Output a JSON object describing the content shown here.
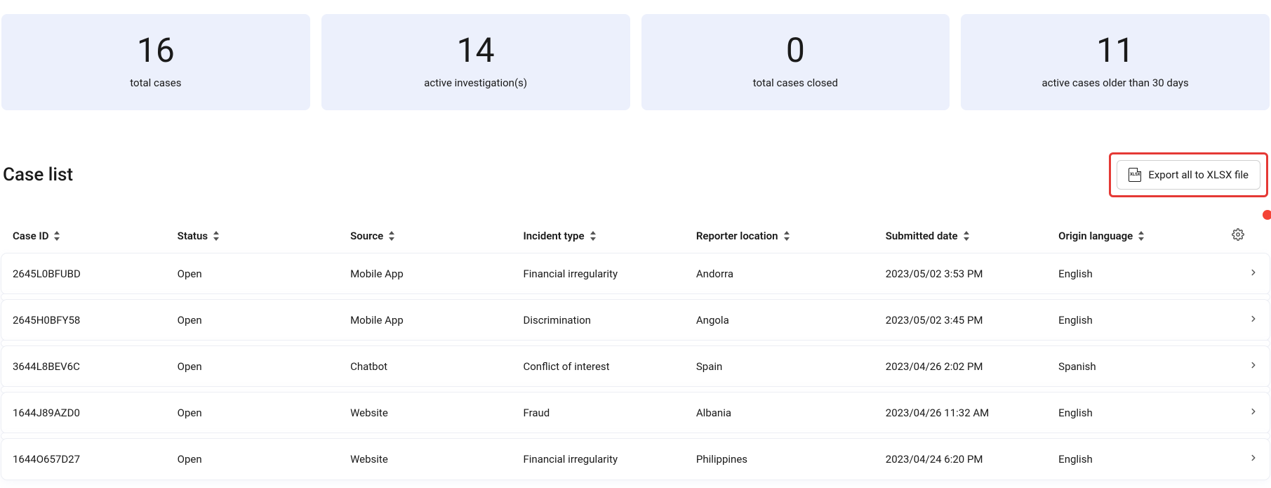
{
  "stats": [
    {
      "value": "16",
      "label": "total cases"
    },
    {
      "value": "14",
      "label": "active investigation(s)"
    },
    {
      "value": "0",
      "label": "total cases closed"
    },
    {
      "value": "11",
      "label": "active cases older than 30 days"
    }
  ],
  "list": {
    "title": "Case list",
    "export_label": "Export all to XLSX file",
    "xlsx_icon_text": "XLSX"
  },
  "columns": {
    "case_id": "Case ID",
    "status": "Status",
    "source": "Source",
    "incident_type": "Incident type",
    "reporter_location": "Reporter location",
    "submitted_date": "Submitted date",
    "origin_language": "Origin language"
  },
  "rows": [
    {
      "case_id": "2645L0BFUBD",
      "status": "Open",
      "source": "Mobile App",
      "incident_type": "Financial irregularity",
      "reporter_location": "Andorra",
      "submitted_date": "2023/05/02 3:53 PM",
      "origin_language": "English"
    },
    {
      "case_id": "2645H0BFY58",
      "status": "Open",
      "source": "Mobile App",
      "incident_type": "Discrimination",
      "reporter_location": "Angola",
      "submitted_date": "2023/05/02 3:45 PM",
      "origin_language": "English"
    },
    {
      "case_id": "3644L8BEV6C",
      "status": "Open",
      "source": "Chatbot",
      "incident_type": "Conflict of interest",
      "reporter_location": "Spain",
      "submitted_date": "2023/04/26 2:02 PM",
      "origin_language": "Spanish"
    },
    {
      "case_id": "1644J89AZD0",
      "status": "Open",
      "source": "Website",
      "incident_type": "Fraud",
      "reporter_location": "Albania",
      "submitted_date": "2023/04/26 11:32 AM",
      "origin_language": "English"
    },
    {
      "case_id": "1644O657D27",
      "status": "Open",
      "source": "Website",
      "incident_type": "Financial irregularity",
      "reporter_location": "Philippines",
      "submitted_date": "2023/04/24 6:20 PM",
      "origin_language": "English"
    }
  ]
}
